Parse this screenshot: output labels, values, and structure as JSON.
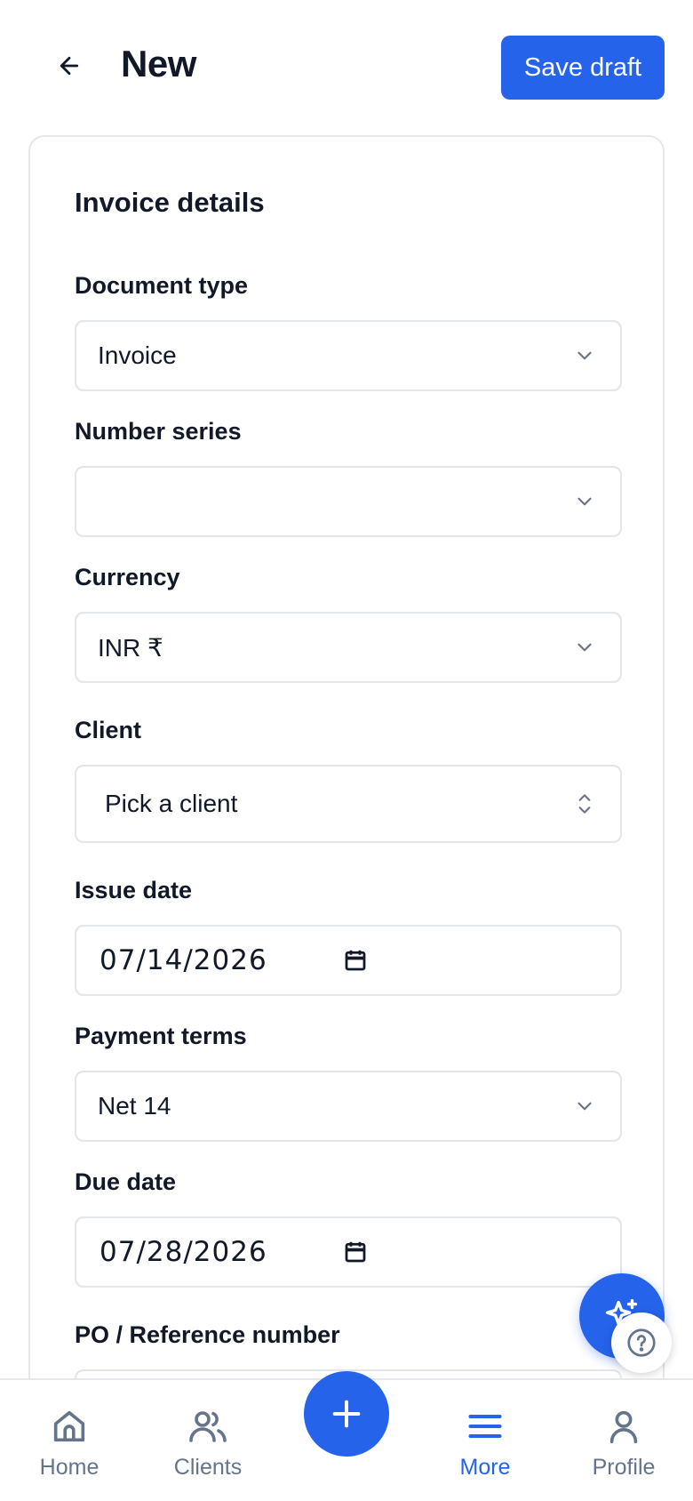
{
  "header": {
    "title": "New",
    "save_label": "Save draft"
  },
  "card": {
    "title": "Invoice details",
    "fields": {
      "document_type": {
        "label": "Document type",
        "value": "Invoice"
      },
      "number_series": {
        "label": "Number series",
        "value": ""
      },
      "currency": {
        "label": "Currency",
        "value": "INR ₹"
      },
      "client": {
        "label": "Client",
        "value": "Pick a client"
      },
      "issue_date": {
        "label": "Issue date",
        "value": "07/14/2026"
      },
      "payment_terms": {
        "label": "Payment terms",
        "value": "Net 14"
      },
      "due_date": {
        "label": "Due date",
        "value": "07/28/2026"
      },
      "po_reference": {
        "label": "PO / Reference number"
      }
    }
  },
  "nav": {
    "home": "Home",
    "clients": "Clients",
    "more": "More",
    "profile": "Profile",
    "active": "More"
  },
  "colors": {
    "accent": "#2563eb",
    "text": "#111827",
    "muted": "#64748b",
    "border": "#e2e5ec"
  },
  "icons": [
    "back-arrow-icon",
    "chevron-down-icon",
    "chevron-up-down-icon",
    "calendar-icon",
    "sparkles-icon",
    "help-circle-icon",
    "home-icon",
    "users-icon",
    "plus-icon",
    "menu-icon",
    "user-icon"
  ]
}
